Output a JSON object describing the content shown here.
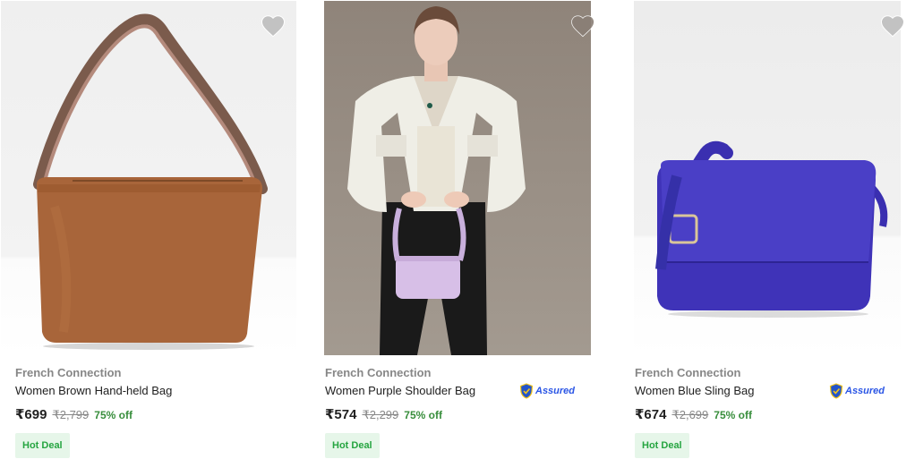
{
  "products": [
    {
      "brand": "French Connection",
      "title": "Women Brown Hand-held Bag",
      "price": "₹699",
      "mrp": "₹2,799",
      "discount": "75% off",
      "badge": "Hot Deal",
      "assured": false,
      "image_icon": "brown-handbag-image"
    },
    {
      "brand": "French Connection",
      "title": "Women Purple Shoulder Bag",
      "price": "₹574",
      "mrp": "₹2,299",
      "discount": "75% off",
      "badge": "Hot Deal",
      "assured": true,
      "assured_label": "Assured",
      "image_icon": "model-with-purple-bag-image"
    },
    {
      "brand": "French Connection",
      "title": "Women Blue Sling Bag",
      "price": "₹674",
      "mrp": "₹2,699",
      "discount": "75% off",
      "badge": "Hot Deal",
      "assured": true,
      "assured_label": "Assured",
      "image_icon": "blue-sling-bag-image"
    }
  ],
  "colors": {
    "brand_grey": "#878787",
    "discount_green": "#388e3c",
    "hot_deal_bg": "#e6f6e9",
    "hot_deal_text": "#26a541",
    "assured_blue": "#2a55e5",
    "wishlist_grey": "#c2c2c2"
  }
}
